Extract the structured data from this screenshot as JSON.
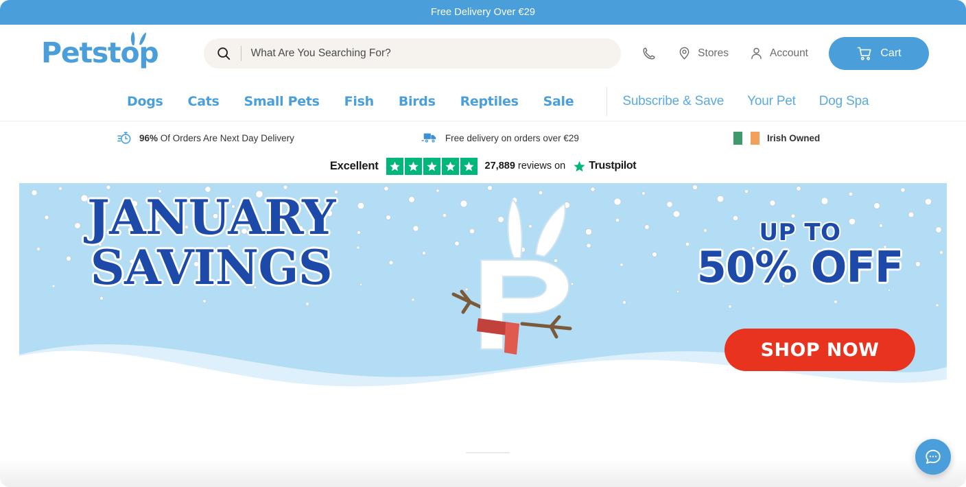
{
  "promo": {
    "text": "Free Delivery Over €29"
  },
  "brand": {
    "name": "Petstop",
    "color": "#4a9fdb"
  },
  "search": {
    "placeholder": "What Are You Searching For?",
    "value": "",
    "icon": "search-icon"
  },
  "header": {
    "phone_icon": "phone-icon",
    "stores_label": "Stores",
    "stores_icon": "map-pin-icon",
    "account_label": "Account",
    "account_icon": "user-icon",
    "cart_label": "Cart",
    "cart_icon": "shopping-cart-icon"
  },
  "nav": {
    "primary": [
      {
        "label": "Dogs"
      },
      {
        "label": "Cats"
      },
      {
        "label": "Small Pets"
      },
      {
        "label": "Fish"
      },
      {
        "label": "Birds"
      },
      {
        "label": "Reptiles"
      },
      {
        "label": "Sale"
      }
    ],
    "secondary": [
      {
        "label": "Subscribe & Save"
      },
      {
        "label": "Your Pet"
      },
      {
        "label": "Dog Spa"
      }
    ]
  },
  "usp": [
    {
      "icon": "stopwatch-icon",
      "strong": "96%",
      "text": " Of Orders Are Next Day Delivery"
    },
    {
      "icon": "delivery-truck-icon",
      "text": "Free delivery on orders over €29"
    },
    {
      "icon": "irish-flag-icon",
      "text": "Irish Owned"
    }
  ],
  "trustpilot": {
    "rating_label": "Excellent",
    "stars": 5,
    "star_color": "#00b67a",
    "count": "27,889",
    "reviews_text": " reviews on ",
    "brand": "Trustpilot"
  },
  "hero": {
    "title_line1": "JANUARY",
    "title_line2": "SAVINGS",
    "up_to": "UP TO",
    "discount": "50% OFF",
    "cta": "SHOP NOW",
    "cta_color": "#e8341f",
    "text_color": "#1d4aa8",
    "sky_color": "#b3ddf5",
    "snow_color": "#ffffff",
    "scarf_color": "#d9453c",
    "mascot": "petstop-p-snowman"
  },
  "chat": {
    "icon": "chat-bubble-icon",
    "color": "#4a9fdb"
  }
}
